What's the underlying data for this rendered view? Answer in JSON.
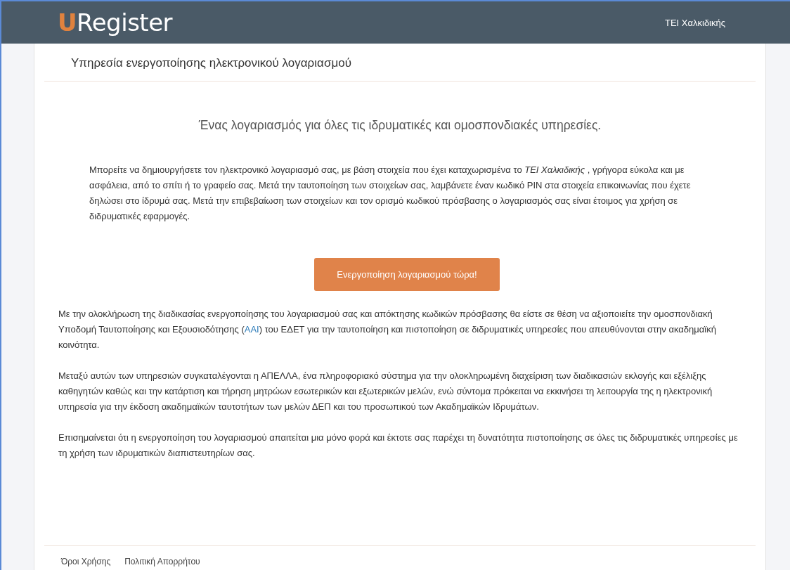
{
  "header": {
    "logo_mark": "U",
    "logo_text": "Register",
    "institution": "ΤΕΙ Χαλκιδικής"
  },
  "card": {
    "title": "Υπηρεσία ενεργοποίησης ηλεκτρονικού λογαριασμού",
    "headline": "Ένας λογαριασμός για όλες τις ιδρυματικές και ομοσπονδιακές υπηρεσίες.",
    "intro": "Μπορείτε να δημιουργήσετε τον ηλεκτρονικό λογαριασμό σας, με βάση στοιχεία που έχει καταχωρισμένα το *ΤΕΙ Χαλκιδικής* , γρήγορα εύκολα και με ασφάλεια, από το σπίτι ή το γραφείο σας. Μετά την ταυτοποίηση των στοιχείων σας, λαμβάνετε έναν κωδικό PIN στα στοιχεία επικοινωνίας που έχετε δηλώσει στο ίδρυμά σας. Μετά την επιβεβαίωση των στοιχείων και τον ορισμό κωδικού πρόσβασης ο λογαριασμός σας είναι έτοιμος για χρήση σε διδρυματικές εφαρμογές.",
    "button": "Ενεργοποίηση λογαριασμού τώρα!",
    "paragraphs": [
      {
        "before": "Με την ολοκλήρωση της διαδικασίας ενεργοποίησης του λογαριασμού σας και απόκτησης κωδικών πρόσβασης θα είστε σε θέση να αξιοποιείτε την ομοσπονδιακή Υποδομή Ταυτοποίησης και Εξουσιοδότησης (",
        "link": "AAI",
        "after": ") του ΕΔΕΤ για την ταυτοποίηση και πιστοποίηση σε διδρυματικές υπηρεσίες που απευθύνονται στην ακαδημαϊκή κοινότητα."
      },
      {
        "before": "Μεταξύ αυτών των υπηρεσιών συγκαταλέγονται η ΑΠΕΛΛΑ, ένα πληροφοριακό σύστημα για την ολοκληρωμένη διαχείριση των διαδικασιών εκλογής και εξέλιξης καθηγητών καθώς και την κατάρτιση και τήρηση μητρώων εσωτερικών και εξωτερικών μελών, ενώ σύντομα πρόκειται να εκκινήσει τη λειτουργία της η ηλεκτρονική υπηρεσία για την έκδοση ακαδημαϊκών ταυτοτήτων των μελών ΔΕΠ και του προσωπικού των Ακαδημαϊκών Ιδρυμάτων."
      },
      {
        "before": "Επισημαίνεται ότι η ενεργοποίηση του λογαριασμού απαιτείται μια μόνο φορά και έκτοτε σας παρέχει τη δυνατότητα πιστοποίησης σε όλες τις διδρυματικές υπηρεσίες με τη χρήση των ιδρυματικών διαπιστευτηρίων σας."
      }
    ],
    "footer_links": [
      "Όροι Χρήσης",
      "Πολιτική Απορρήτου"
    ]
  }
}
